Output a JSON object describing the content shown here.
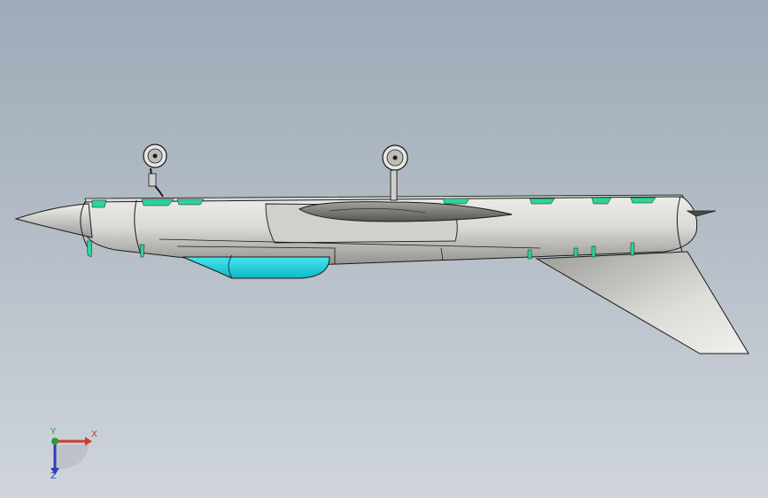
{
  "viewport": {
    "model_name": "aircraft-fuselage-side-view",
    "colors": {
      "background_top": "#9daab8",
      "background_bottom": "#d0d5dc",
      "fuselage": "#d6d6d2",
      "edge": "#1a1a1a",
      "canopy": "#7d7d7b",
      "accent_green": "#2ed39a",
      "pod_cyan": "#22d6e6"
    }
  },
  "triad": {
    "x_label": "X",
    "y_label": "Y",
    "z_label": "Z",
    "x_color": "#d23a2a",
    "y_color": "#2e9b3a",
    "z_color": "#2a3fb8"
  }
}
